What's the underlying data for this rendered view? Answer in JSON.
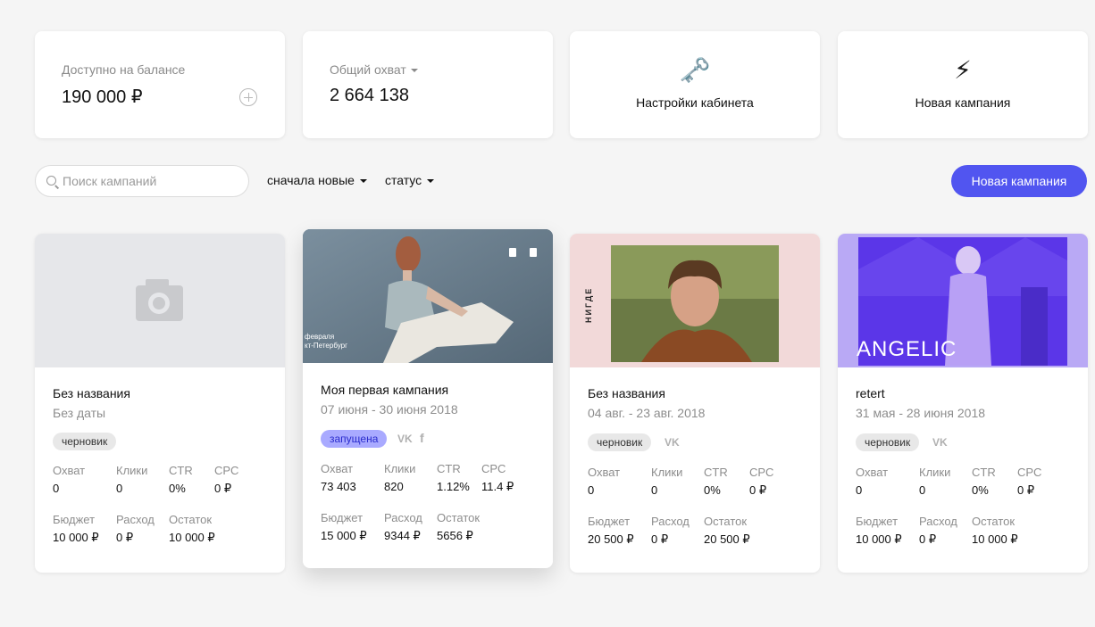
{
  "summary": {
    "balance_label": "Доступно на балансе",
    "balance_value": "190 000 ₽",
    "reach_label": "Общий охват",
    "reach_value": "2 664 138"
  },
  "actions": {
    "settings_label": "Настройки кабинета",
    "settings_icon": "🗝️",
    "new_campaign_label": "Новая кампания",
    "new_campaign_icon": "⚡"
  },
  "filters": {
    "search_placeholder": "Поиск кампаний",
    "sort_label": "сначала новые",
    "status_label": "статус",
    "new_campaign_button": "Новая кампания"
  },
  "stat_labels": {
    "reach": "Охват",
    "clicks": "Клики",
    "ctr": "CTR",
    "cpc": "CPC",
    "budget": "Бюджет",
    "spent": "Расход",
    "remaining": "Остаток"
  },
  "campaigns": [
    {
      "title": "Без названия",
      "date": "Без даты",
      "status": "черновик",
      "reach": "0",
      "clicks": "0",
      "ctr": "0%",
      "cpc": "0 ₽",
      "budget": "10 000 ₽",
      "spent": "0 ₽",
      "remaining": "10 000 ₽"
    },
    {
      "title": "Моя первая кампания",
      "date": "07 июня - 30 июня 2018",
      "status": "запущена",
      "image_text": [
        "февраля",
        "кт-Петербург"
      ],
      "reach": "73 403",
      "clicks": "820",
      "ctr": "1.12%",
      "cpc": "11.4 ₽",
      "budget": "15 000 ₽",
      "spent": "9344 ₽",
      "remaining": "5656 ₽"
    },
    {
      "title": "Без названия",
      "date": "04 авг. - 23 авг. 2018",
      "status": "черновик",
      "image_text": "НИГДЕ",
      "reach": "0",
      "clicks": "0",
      "ctr": "0%",
      "cpc": "0 ₽",
      "budget": "20 500 ₽",
      "spent": "0 ₽",
      "remaining": "20 500 ₽"
    },
    {
      "title": "retert",
      "date": "31 мая - 28 июня 2018",
      "status": "черновик",
      "image_text": "ANGELIC",
      "reach": "0",
      "clicks": "0",
      "ctr": "0%",
      "cpc": "0 ₽",
      "budget": "10 000 ₽",
      "spent": "0 ₽",
      "remaining": "10 000 ₽"
    }
  ],
  "colors": {
    "accent": "#5155f0",
    "badge_active_bg": "#a9aaff",
    "badge_draft_bg": "#e8e8e8",
    "image3_bg": "#f2d9d9",
    "image4_bg": "#b9a9f5"
  }
}
